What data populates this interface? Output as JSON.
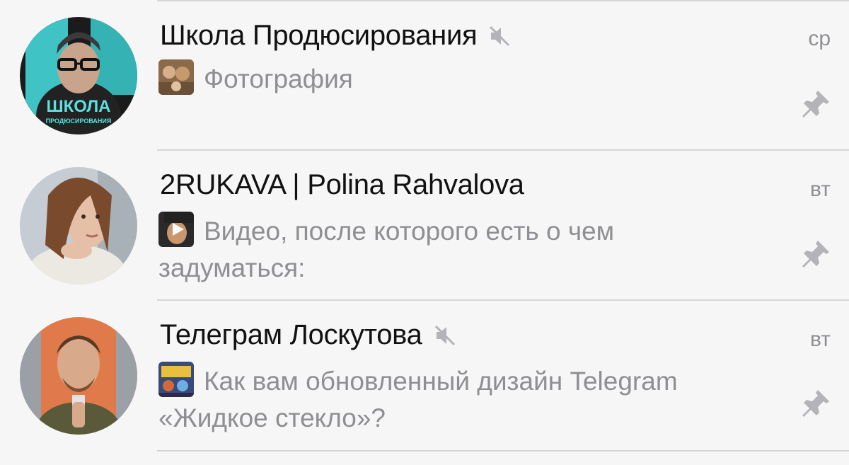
{
  "chats": [
    {
      "title": "Школа Продюсирования",
      "time": "ср",
      "muted": true,
      "pinned": true,
      "preview": "Фотография",
      "avatar_caption": "ШКОЛА",
      "avatar_subcaption": "ПРОДЮСИРОВАНИЯ"
    },
    {
      "title": "2RUKAVA | Polina Rahvalova",
      "time": "вт",
      "muted": false,
      "pinned": true,
      "preview": "Видео, после которого есть о чем задуматься:"
    },
    {
      "title": "Телеграм Лоскутова",
      "time": "вт",
      "muted": true,
      "pinned": true,
      "preview": "Как вам обновленный дизайн Telegram «Жидкое стекло»?"
    }
  ],
  "colors": {
    "background": "#f6f6f6",
    "title_text": "#111111",
    "secondary_text": "#8e8e93",
    "divider": "#d6d6d6",
    "avatar1_teal": "#3fc3c4",
    "avatar3_orange": "#e07a4a"
  },
  "icons": {
    "mute": "speaker-muted-icon",
    "pin": "pin-icon",
    "video_play": "play-icon"
  }
}
